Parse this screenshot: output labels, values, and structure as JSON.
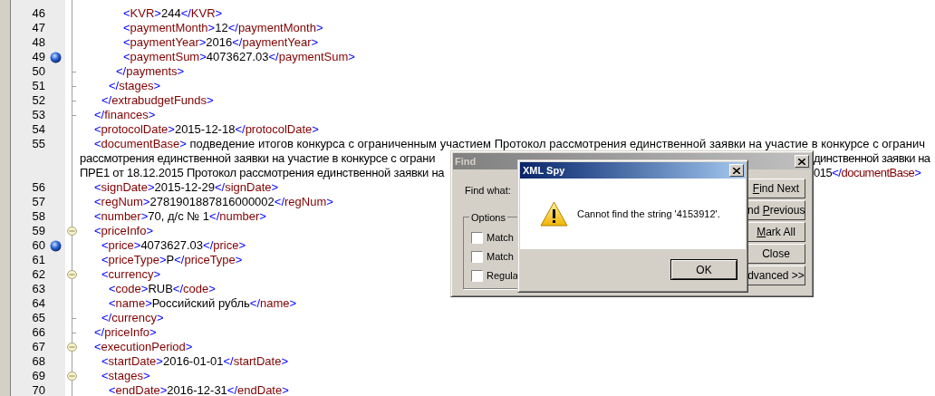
{
  "editor": {
    "lines": [
      {
        "children": [
          {
            "children": [
              {
                "children": [
                  {
                    "children": [
                      {
                        "number": "46",
                        "tokens": [
                          {
                            "kind": "punct",
                            "text": "<"
                          },
                          {
                            "kind": "tag",
                            "text": "KVR"
                          },
                          {
                            "kind": "punct",
                            "text": ">"
                          },
                          {
                            "kind": "value",
                            "text": "244"
                          },
                          {
                            "kind": "punct",
                            "text": "</"
                          },
                          {
                            "kind": "tag",
                            "text": "KVR"
                          },
                          {
                            "kind": "punct",
                            "text": ">"
                          }
                        ]
                      },
                      {
                        "number": "47",
                        "tokens": [
                          {
                            "kind": "punct",
                            "text": "<"
                          },
                          {
                            "kind": "tag",
                            "text": "paymentMonth"
                          },
                          {
                            "kind": "punct",
                            "text": ">"
                          },
                          {
                            "kind": "value",
                            "text": "12"
                          },
                          {
                            "kind": "punct",
                            "text": "</"
                          },
                          {
                            "kind": "tag",
                            "text": "paymentMonth"
                          },
                          {
                            "kind": "punct",
                            "text": ">"
                          }
                        ]
                      },
                      {
                        "number": "48",
                        "tokens": [
                          {
                            "kind": "punct",
                            "text": "<"
                          },
                          {
                            "kind": "tag",
                            "text": "paymentYear"
                          },
                          {
                            "kind": "punct",
                            "text": ">"
                          },
                          {
                            "kind": "value",
                            "text": "2016"
                          },
                          {
                            "kind": "punct",
                            "text": "</"
                          },
                          {
                            "kind": "tag",
                            "text": "paymentYear"
                          },
                          {
                            "kind": "punct",
                            "text": ">"
                          }
                        ]
                      },
                      {
                        "number": "49",
                        "bookmark": true,
                        "tokens": [
                          {
                            "kind": "punct",
                            "text": "<"
                          },
                          {
                            "kind": "tag",
                            "text": "paymentSum"
                          },
                          {
                            "kind": "punct",
                            "text": ">"
                          },
                          {
                            "kind": "value",
                            "text": "4073627.03"
                          },
                          {
                            "kind": "punct",
                            "text": "</"
                          },
                          {
                            "kind": "tag",
                            "text": "paymentSum"
                          },
                          {
                            "kind": "punct",
                            "text": ">"
                          }
                        ]
                      }
                    ]
                  },
                  {
                    "number": "50",
                    "block_end": true,
                    "tokens": [
                      {
                        "kind": "punct",
                        "text": "</"
                      },
                      {
                        "kind": "tag",
                        "text": "payments"
                      },
                      {
                        "kind": "punct",
                        "text": ">"
                      }
                    ]
                  }
                ]
              },
              {
                "number": "51",
                "block_end": true,
                "tokens": [
                  {
                    "kind": "punct",
                    "text": "</"
                  },
                  {
                    "kind": "tag",
                    "text": "stages"
                  },
                  {
                    "kind": "punct",
                    "text": ">"
                  }
                ]
              }
            ]
          },
          {
            "number": "52",
            "block_end": true,
            "tokens": [
              {
                "kind": "punct",
                "text": "</"
              },
              {
                "kind": "tag",
                "text": "extrabudgetFunds"
              },
              {
                "kind": "punct",
                "text": ">"
              }
            ]
          }
        ]
      },
      {
        "number": "53",
        "block_end": true,
        "tokens": [
          {
            "kind": "punct",
            "text": "</"
          },
          {
            "kind": "tag",
            "text": "finances"
          },
          {
            "kind": "punct",
            "text": ">"
          }
        ]
      },
      {
        "number": "54",
        "tokens": [
          {
            "kind": "punct",
            "text": "<"
          },
          {
            "kind": "tag",
            "text": "protocolDate"
          },
          {
            "kind": "punct",
            "text": ">"
          },
          {
            "kind": "value",
            "text": "2015-12-18"
          },
          {
            "kind": "punct",
            "text": "</"
          },
          {
            "kind": "tag",
            "text": "protocolDate"
          },
          {
            "kind": "punct",
            "text": ">"
          }
        ]
      },
      {
        "number": "55",
        "tokens": [
          {
            "kind": "punct",
            "text": "<"
          },
          {
            "kind": "tag",
            "text": "documentBase"
          },
          {
            "kind": "punct",
            "text": ">"
          },
          {
            "kind": "value",
            "text": "    подведение итогов конкурса с ограниченным участием Протокол рассмотрения единственной заявки на участие в конкурсе с огранич"
          }
        ],
        "wrapped": [
          {
            "left": [
              {
                "kind": "value",
                "text": "рассмотрения единственной заявки на участие в конкурсе с ограни"
              }
            ],
            "right": [
              {
                "kind": "value",
                "text": "динственной заявки на"
              }
            ]
          },
          {
            "left": [
              {
                "kind": "value",
                "text": "ПРЕ1 от 18.12.2015 Протокол рассмотрения единственной заявки на"
              }
            ],
            "right": [
              {
                "kind": "value",
                "text": "015"
              },
              {
                "kind": "punct",
                "text": "</"
              },
              {
                "kind": "tag",
                "text": "documentBase"
              },
              {
                "kind": "punct",
                "text": ">"
              }
            ]
          }
        ]
      },
      {
        "number": "56",
        "tokens": [
          {
            "kind": "punct",
            "text": "<"
          },
          {
            "kind": "tag",
            "text": "signDate"
          },
          {
            "kind": "punct",
            "text": ">"
          },
          {
            "kind": "value",
            "text": "2015-12-29"
          },
          {
            "kind": "punct",
            "text": "</"
          },
          {
            "kind": "tag",
            "text": "signDate"
          },
          {
            "kind": "punct",
            "text": ">"
          }
        ]
      },
      {
        "number": "57",
        "tokens": [
          {
            "kind": "punct",
            "text": "<"
          },
          {
            "kind": "tag",
            "text": "regNum"
          },
          {
            "kind": "punct",
            "text": ">"
          },
          {
            "kind": "value",
            "text": "2781901887816000002"
          },
          {
            "kind": "punct",
            "text": "</"
          },
          {
            "kind": "tag",
            "text": "regNum"
          },
          {
            "kind": "punct",
            "text": ">"
          }
        ]
      },
      {
        "number": "58",
        "tokens": [
          {
            "kind": "punct",
            "text": "<"
          },
          {
            "kind": "tag",
            "text": "number"
          },
          {
            "kind": "punct",
            "text": ">"
          },
          {
            "kind": "value",
            "text": "70, д/с № 1"
          },
          {
            "kind": "punct",
            "text": "</"
          },
          {
            "kind": "tag",
            "text": "number"
          },
          {
            "kind": "punct",
            "text": ">"
          }
        ]
      },
      {
        "number": "59",
        "collapsible": true,
        "tokens": [
          {
            "kind": "punct",
            "text": "<"
          },
          {
            "kind": "tag",
            "text": "priceInfo"
          },
          {
            "kind": "punct",
            "text": ">"
          }
        ],
        "children": [
          {
            "number": "60",
            "bookmark": true,
            "tokens": [
              {
                "kind": "punct",
                "text": "<"
              },
              {
                "kind": "tag",
                "text": "price"
              },
              {
                "kind": "punct",
                "text": ">"
              },
              {
                "kind": "value",
                "text": "4073627.03"
              },
              {
                "kind": "punct",
                "text": "</"
              },
              {
                "kind": "tag",
                "text": "price"
              },
              {
                "kind": "punct",
                "text": ">"
              }
            ]
          },
          {
            "number": "61",
            "tokens": [
              {
                "kind": "punct",
                "text": "<"
              },
              {
                "kind": "tag",
                "text": "priceType"
              },
              {
                "kind": "punct",
                "text": ">"
              },
              {
                "kind": "value",
                "text": "P"
              },
              {
                "kind": "punct",
                "text": "</"
              },
              {
                "kind": "tag",
                "text": "priceType"
              },
              {
                "kind": "punct",
                "text": ">"
              }
            ]
          },
          {
            "number": "62",
            "collapsible": true,
            "tokens": [
              {
                "kind": "punct",
                "text": "<"
              },
              {
                "kind": "tag",
                "text": "currency"
              },
              {
                "kind": "punct",
                "text": ">"
              }
            ],
            "children": [
              {
                "number": "63",
                "tokens": [
                  {
                    "kind": "punct",
                    "text": "<"
                  },
                  {
                    "kind": "tag",
                    "text": "code"
                  },
                  {
                    "kind": "punct",
                    "text": ">"
                  },
                  {
                    "kind": "value",
                    "text": "RUB"
                  },
                  {
                    "kind": "punct",
                    "text": "</"
                  },
                  {
                    "kind": "tag",
                    "text": "code"
                  },
                  {
                    "kind": "punct",
                    "text": ">"
                  }
                ]
              },
              {
                "number": "64",
                "tokens": [
                  {
                    "kind": "punct",
                    "text": "<"
                  },
                  {
                    "kind": "tag",
                    "text": "name"
                  },
                  {
                    "kind": "punct",
                    "text": ">"
                  },
                  {
                    "kind": "value",
                    "text": "Российский рубль"
                  },
                  {
                    "kind": "punct",
                    "text": "</"
                  },
                  {
                    "kind": "tag",
                    "text": "name"
                  },
                  {
                    "kind": "punct",
                    "text": ">"
                  }
                ]
              }
            ]
          },
          {
            "number": "65",
            "block_end": true,
            "tokens": [
              {
                "kind": "punct",
                "text": "</"
              },
              {
                "kind": "tag",
                "text": "currency"
              },
              {
                "kind": "punct",
                "text": ">"
              }
            ]
          }
        ]
      },
      {
        "number": "66",
        "block_end": true,
        "tokens": [
          {
            "kind": "punct",
            "text": "</"
          },
          {
            "kind": "tag",
            "text": "priceInfo"
          },
          {
            "kind": "punct",
            "text": ">"
          }
        ]
      },
      {
        "number": "67",
        "collapsible": true,
        "tokens": [
          {
            "kind": "punct",
            "text": "<"
          },
          {
            "kind": "tag",
            "text": "executionPeriod"
          },
          {
            "kind": "punct",
            "text": ">"
          }
        ],
        "children": [
          {
            "number": "68",
            "tokens": [
              {
                "kind": "punct",
                "text": "<"
              },
              {
                "kind": "tag",
                "text": "startDate"
              },
              {
                "kind": "punct",
                "text": ">"
              },
              {
                "kind": "value",
                "text": "2016-01-01"
              },
              {
                "kind": "punct",
                "text": "</"
              },
              {
                "kind": "tag",
                "text": "startDate"
              },
              {
                "kind": "punct",
                "text": ">"
              }
            ]
          },
          {
            "number": "69",
            "collapsible": true,
            "tokens": [
              {
                "kind": "punct",
                "text": "<"
              },
              {
                "kind": "tag",
                "text": "stages"
              },
              {
                "kind": "punct",
                "text": ">"
              }
            ],
            "children": [
              {
                "number": "70",
                "tokens": [
                  {
                    "kind": "punct",
                    "text": "<"
                  },
                  {
                    "kind": "tag",
                    "text": "endDate"
                  },
                  {
                    "kind": "punct",
                    "text": ">"
                  },
                  {
                    "kind": "value",
                    "text": "2016-12-31"
                  },
                  {
                    "kind": "punct",
                    "text": "</"
                  },
                  {
                    "kind": "tag",
                    "text": "endDate"
                  },
                  {
                    "kind": "punct",
                    "text": ">"
                  }
                ]
              }
            ]
          }
        ]
      }
    ]
  },
  "find_dialog": {
    "title": "Find",
    "active": false,
    "find_what_label": "Find what:",
    "options_legend": "Options",
    "options": [
      {
        "label": "Match",
        "checked": false
      },
      {
        "label": "Match",
        "checked": false
      },
      {
        "label": "Regula",
        "checked": false
      }
    ],
    "buttons": [
      {
        "accel": "F",
        "post": "ind Next"
      },
      {
        "pre": "nd ",
        "accel": "P",
        "post": "revious"
      },
      {
        "accel": "M",
        "post": "ark All"
      },
      {
        "pre": "Close"
      },
      {
        "pre": "dvanced >>"
      }
    ]
  },
  "message_box": {
    "title": "XML Spy",
    "active": true,
    "message": "Cannot find the string '4153912'.",
    "buttons": [
      {
        "label": "OK",
        "default": true
      }
    ]
  }
}
